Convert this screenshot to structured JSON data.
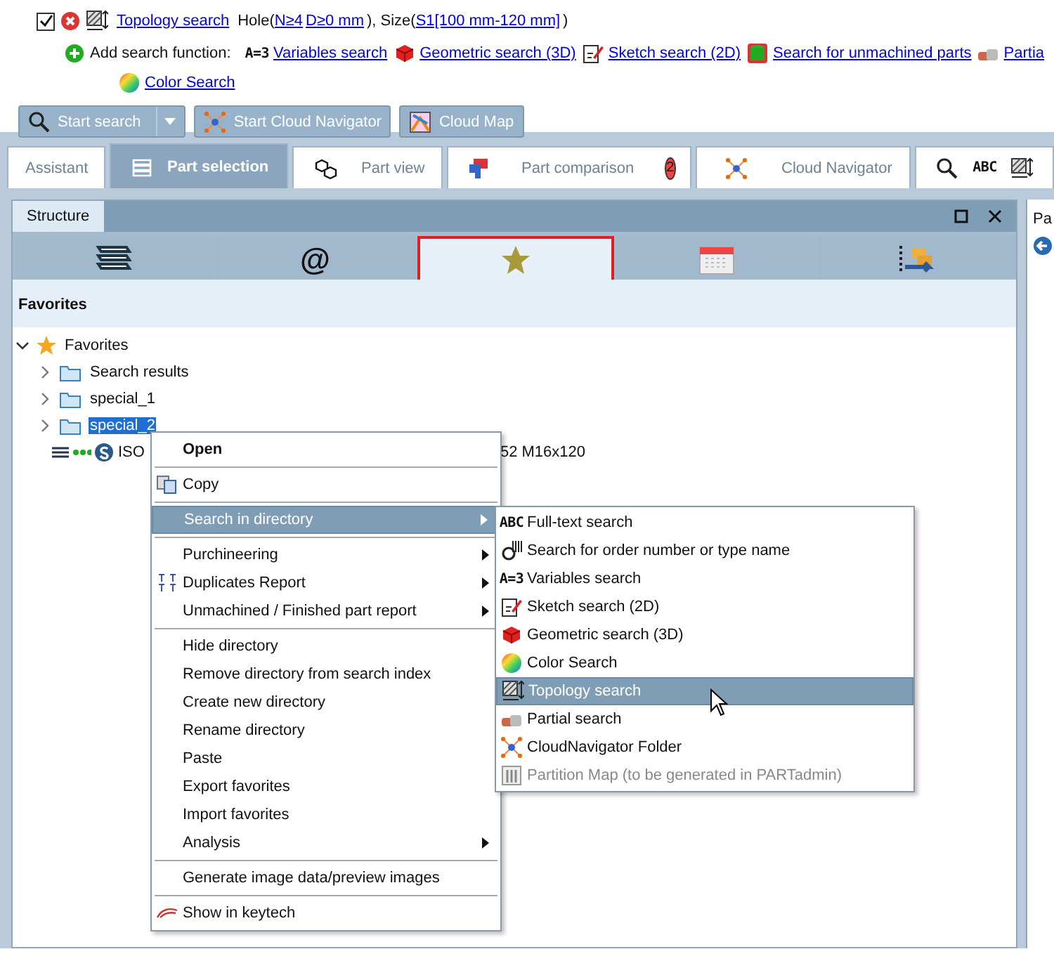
{
  "search_line": {
    "checked": true,
    "title_link": "Topology search",
    "parts": [
      {
        "kind": "text",
        "text": "Hole("
      },
      {
        "kind": "link",
        "text": "N≥4"
      },
      {
        "kind": "link",
        "text": "D≥0 mm"
      },
      {
        "kind": "text",
        "text": "), Size("
      },
      {
        "kind": "link",
        "text": "S1[100 mm-120 mm]"
      },
      {
        "kind": "text",
        "text": ")"
      }
    ]
  },
  "add_functions": {
    "label": "Add search function:",
    "items": [
      {
        "label": "Variables search",
        "icon_text": "A=3"
      },
      {
        "label": "Geometric search (3D)"
      },
      {
        "label": "Sketch search (2D)"
      },
      {
        "label": "Search for unmachined parts"
      },
      {
        "label": "Partia"
      },
      {
        "label": "Color Search"
      }
    ]
  },
  "toolbar": [
    {
      "label": "Start search",
      "dropdown": true
    },
    {
      "label": "Start Cloud Navigator",
      "dropdown": false
    },
    {
      "label": "Cloud Map",
      "dropdown": false
    }
  ],
  "tabs": [
    {
      "label": "Assistant",
      "selected": false
    },
    {
      "label": "Part selection",
      "selected": true
    },
    {
      "label": "Part view",
      "selected": false
    },
    {
      "label": "Part comparison",
      "selected": false,
      "badge": "2"
    },
    {
      "label": "Cloud Navigator",
      "selected": false
    },
    {
      "icon_text": "ABC",
      "selected": false
    }
  ],
  "panel": {
    "title": "Structure",
    "view_buttons": [
      {
        "selected": false
      },
      {
        "selected": false,
        "icon_text": "@"
      },
      {
        "selected": true
      },
      {
        "selected": false
      },
      {
        "selected": false
      }
    ],
    "section": "Favorites"
  },
  "tree": [
    {
      "kind": "root",
      "label": "Favorites",
      "expanded": true,
      "children": [
        {
          "kind": "folder",
          "label": "Search results",
          "expanded": false,
          "selected": false
        },
        {
          "kind": "folder",
          "label": "special_1",
          "expanded": false,
          "selected": false
        },
        {
          "kind": "folder",
          "label": "special_2",
          "expanded": false,
          "selected": true
        },
        {
          "kind": "part",
          "label": "ISO",
          "label_end": "52 M16x120",
          "selected": false
        }
      ]
    }
  ],
  "right_panel": {
    "title": "Pa"
  },
  "context_menu": [
    {
      "label": "Open",
      "bold": true,
      "submenu": false,
      "selected": false
    },
    {
      "kind": "separator"
    },
    {
      "label": "Copy",
      "submenu": false,
      "selected": false
    },
    {
      "kind": "separator"
    },
    {
      "label": "Search in directory",
      "submenu": true,
      "selected": true
    },
    {
      "kind": "separator"
    },
    {
      "label": "Purchineering",
      "submenu": true,
      "selected": false
    },
    {
      "label": "Duplicates Report",
      "submenu": true,
      "selected": false
    },
    {
      "label": "Unmachined / Finished part report",
      "submenu": true,
      "selected": false
    },
    {
      "kind": "separator"
    },
    {
      "label": "Hide directory",
      "submenu": false,
      "selected": false
    },
    {
      "label": "Remove directory from search index",
      "submenu": false,
      "selected": false
    },
    {
      "label": "Create new directory",
      "submenu": false,
      "selected": false
    },
    {
      "label": "Rename directory",
      "submenu": false,
      "selected": false
    },
    {
      "label": "Paste",
      "submenu": false,
      "selected": false
    },
    {
      "label": "Export favorites",
      "submenu": false,
      "selected": false
    },
    {
      "label": "Import favorites",
      "submenu": false,
      "selected": false
    },
    {
      "label": "Analysis",
      "submenu": true,
      "selected": false
    },
    {
      "kind": "separator"
    },
    {
      "label": "Generate image data/preview images",
      "submenu": false,
      "selected": false
    },
    {
      "kind": "separator"
    },
    {
      "label": "Show in keytech",
      "submenu": false,
      "selected": false
    }
  ],
  "submenu": [
    {
      "label": "Full-text search",
      "icon_text": "ABC",
      "selected": false,
      "disabled": false
    },
    {
      "label": "Search for order number or type name",
      "selected": false,
      "disabled": false
    },
    {
      "label": "Variables search",
      "icon_text": "A=3",
      "selected": false,
      "disabled": false
    },
    {
      "label": "Sketch search (2D)",
      "selected": false,
      "disabled": false
    },
    {
      "label": "Geometric search (3D)",
      "selected": false,
      "disabled": false
    },
    {
      "label": "Color Search",
      "selected": false,
      "disabled": false
    },
    {
      "label": "Topology search",
      "selected": true,
      "disabled": false
    },
    {
      "label": "Partial search",
      "selected": false,
      "disabled": false
    },
    {
      "label": "CloudNavigator Folder",
      "selected": false,
      "disabled": false
    },
    {
      "label": "Partition Map (to be generated in PARTadmin)",
      "selected": false,
      "disabled": true
    }
  ]
}
